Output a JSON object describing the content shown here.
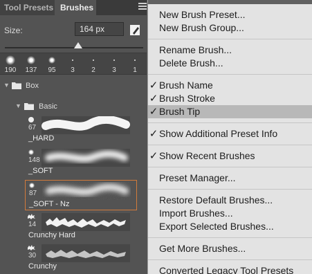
{
  "panel": {
    "tabs": [
      {
        "label": "Tool Presets",
        "active": false
      },
      {
        "label": "Brushes",
        "active": true
      }
    ],
    "size_label": "Size:",
    "size_value": "164 px",
    "slider_fraction": 0.55,
    "recent_brushes": [
      "190",
      "137",
      "95",
      "3",
      "2",
      "3",
      "1"
    ],
    "groups": [
      {
        "name": "Box",
        "expanded": true
      },
      {
        "name": "Basic",
        "expanded": true
      }
    ],
    "brushes": [
      {
        "size": "67",
        "name": "_HARD",
        "selected": false
      },
      {
        "size": "148",
        "name": "_SOFT",
        "selected": false
      },
      {
        "size": "87",
        "name": "_SOFT - Nz",
        "selected": true
      },
      {
        "size": "14",
        "name": "Crunchy Hard",
        "selected": false
      },
      {
        "size": "30",
        "name": "Crunchy",
        "selected": false
      }
    ]
  },
  "menu": {
    "sections": [
      [
        {
          "label": "New Brush Preset...",
          "checked": false
        },
        {
          "label": "New Brush Group...",
          "checked": false
        }
      ],
      [
        {
          "label": "Rename Brush...",
          "checked": false
        },
        {
          "label": "Delete Brush...",
          "checked": false
        }
      ],
      [
        {
          "label": "Brush Name",
          "checked": true
        },
        {
          "label": "Brush Stroke",
          "checked": true
        },
        {
          "label": "Brush Tip",
          "checked": true,
          "highlighted": true
        }
      ],
      [
        {
          "label": "Show Additional Preset Info",
          "checked": true
        }
      ],
      [
        {
          "label": "Show Recent Brushes",
          "checked": true
        }
      ],
      [
        {
          "label": "Preset Manager...",
          "checked": false
        }
      ],
      [
        {
          "label": "Restore Default Brushes...",
          "checked": false
        },
        {
          "label": "Import Brushes...",
          "checked": false
        },
        {
          "label": "Export Selected Brushes...",
          "checked": false
        }
      ],
      [
        {
          "label": "Get More Brushes...",
          "checked": false
        }
      ],
      [
        {
          "label": "Converted Legacy Tool Presets",
          "checked": false
        }
      ]
    ],
    "check_glyph": "✓"
  },
  "colors": {
    "panel_bg": "#535353",
    "menu_bg": "#e3e3e3",
    "menu_highlight": "#b8b8b8",
    "selection_border": "#d27b3b"
  }
}
